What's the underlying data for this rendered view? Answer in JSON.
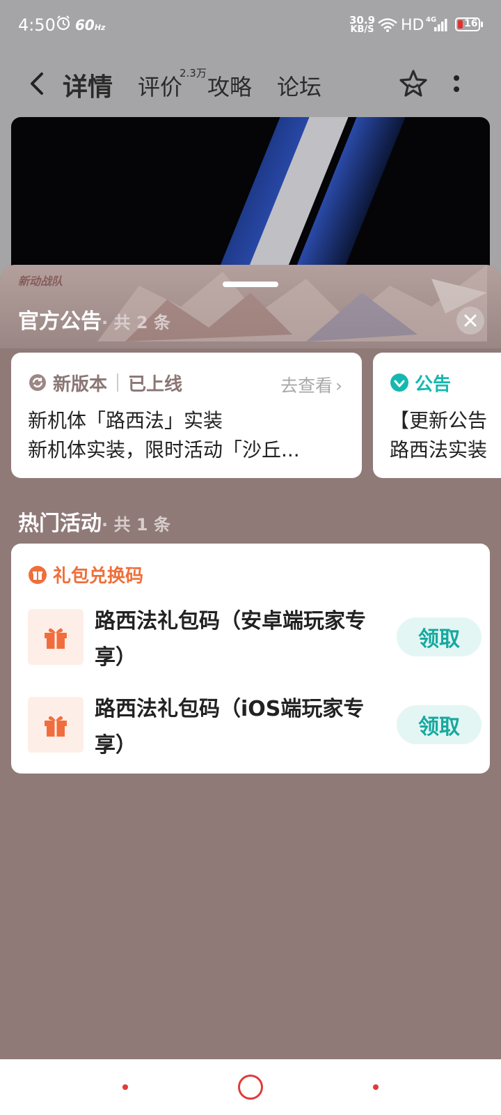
{
  "status_bar": {
    "time": "4:50",
    "refresh_rate": "60",
    "refresh_unit": "Hz",
    "net_speed_value": "30.9",
    "net_speed_unit": "KB/S",
    "hd_label": "HD",
    "network_type": "4G",
    "battery_level": "16"
  },
  "nav": {
    "tabs": [
      {
        "label": "详情",
        "active": true
      },
      {
        "label": "评价"
      },
      {
        "label": "攻略"
      },
      {
        "label": "论坛"
      }
    ],
    "review_count": "2.3万"
  },
  "sheet": {
    "logo_text": "新动战队",
    "announcements": {
      "title": "官方公告",
      "count_label": "· 共 2 条",
      "cards": [
        {
          "type": "新版本",
          "status": "已上线",
          "action": "去查看",
          "line1": "新机体「路西法」实装",
          "line2": "新机体实装，限时活动「沙丘..."
        },
        {
          "type": "公告",
          "line1": "【更新公告",
          "line2": "路西法实装"
        }
      ]
    },
    "activities": {
      "title": "热门活动",
      "count_label": "· 共 1 条",
      "card_title": "礼包兑换码",
      "items": [
        {
          "name": "路西法礼包码（安卓端玩家专享）",
          "button": "领取"
        },
        {
          "name": "路西法礼包码（iOS端玩家专享）",
          "button": "领取"
        }
      ]
    }
  },
  "colors": {
    "accent": "#15a9a3",
    "orange": "#ef6f3a",
    "sheet_bg": "#8f7a78"
  },
  "icons": [
    "alarm-icon",
    "wifi-icon",
    "signal-icon",
    "battery-icon",
    "back-icon",
    "favorite-star-icon",
    "more-icon",
    "close-icon",
    "refresh-icon",
    "heart-badge-icon",
    "gift-icon",
    "chevron-right-icon"
  ]
}
